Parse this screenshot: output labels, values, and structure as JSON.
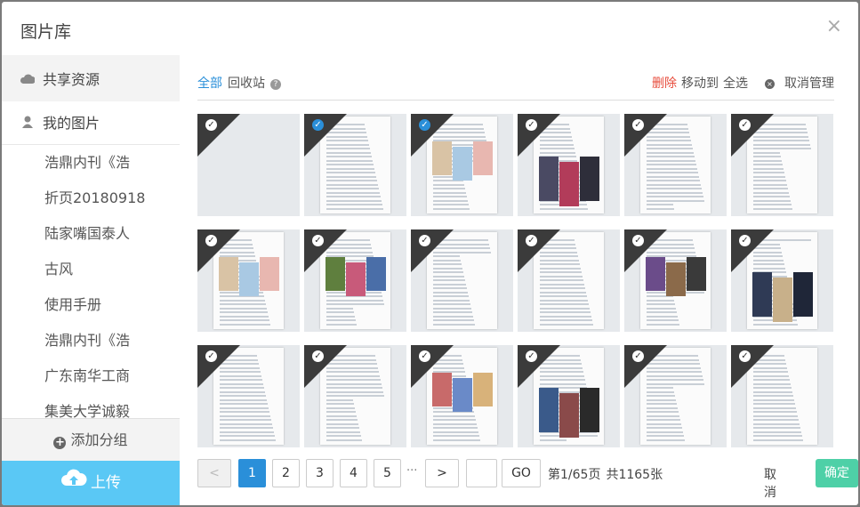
{
  "dialog": {
    "title": "图片库",
    "close_glyph": "×"
  },
  "sidebar": {
    "shared": {
      "label": "共享资源",
      "icon": "cloud-icon"
    },
    "mine": {
      "label": "我的图片",
      "icon": "user-icon"
    },
    "folders": [
      "浩鼎内刊《浩",
      "折页20180918",
      "陆家嘴国泰人",
      "古风",
      "使用手册",
      "浩鼎内刊《浩",
      "广东南华工商",
      "集美大学诚毅"
    ],
    "add_group": {
      "label": "添加分组",
      "plus": "+"
    },
    "upload": {
      "label": "上传"
    }
  },
  "toolbar": {
    "all": "全部",
    "recycle": "回收站",
    "help": "?",
    "delete": "删除",
    "move_to": "移动到",
    "select_all": "全选",
    "cancel_manage": "取消管理",
    "cancel_icon": "×"
  },
  "thumbnails": [
    {
      "selected": false,
      "kind": "blank"
    },
    {
      "selected": true,
      "kind": "text"
    },
    {
      "selected": true,
      "kind": "comic"
    },
    {
      "selected": false,
      "kind": "photo-people"
    },
    {
      "selected": false,
      "kind": "text"
    },
    {
      "selected": false,
      "kind": "text"
    },
    {
      "selected": false,
      "kind": "comic"
    },
    {
      "selected": false,
      "kind": "illustration"
    },
    {
      "selected": false,
      "kind": "text"
    },
    {
      "selected": false,
      "kind": "text"
    },
    {
      "selected": false,
      "kind": "clothes"
    },
    {
      "selected": false,
      "kind": "photo-man"
    },
    {
      "selected": false,
      "kind": "text"
    },
    {
      "selected": false,
      "kind": "text"
    },
    {
      "selected": false,
      "kind": "clothes-illus"
    },
    {
      "selected": false,
      "kind": "photo-shop"
    },
    {
      "selected": false,
      "kind": "text"
    },
    {
      "selected": false,
      "kind": "text"
    }
  ],
  "pagination": {
    "prev": "<",
    "pages": [
      "1",
      "2",
      "3",
      "4",
      "5"
    ],
    "current": "1",
    "ellipsis": "···",
    "next": ">",
    "jump_value": "",
    "go": "GO",
    "page_info": "第1/65页",
    "total_info": "共1165张"
  },
  "footer": {
    "cancel": "取消",
    "ok": "确定"
  },
  "colors": {
    "accent": "#2a8fd9",
    "upload": "#5ac8f5",
    "confirm": "#4ed0a7",
    "danger": "#e74c3c"
  }
}
